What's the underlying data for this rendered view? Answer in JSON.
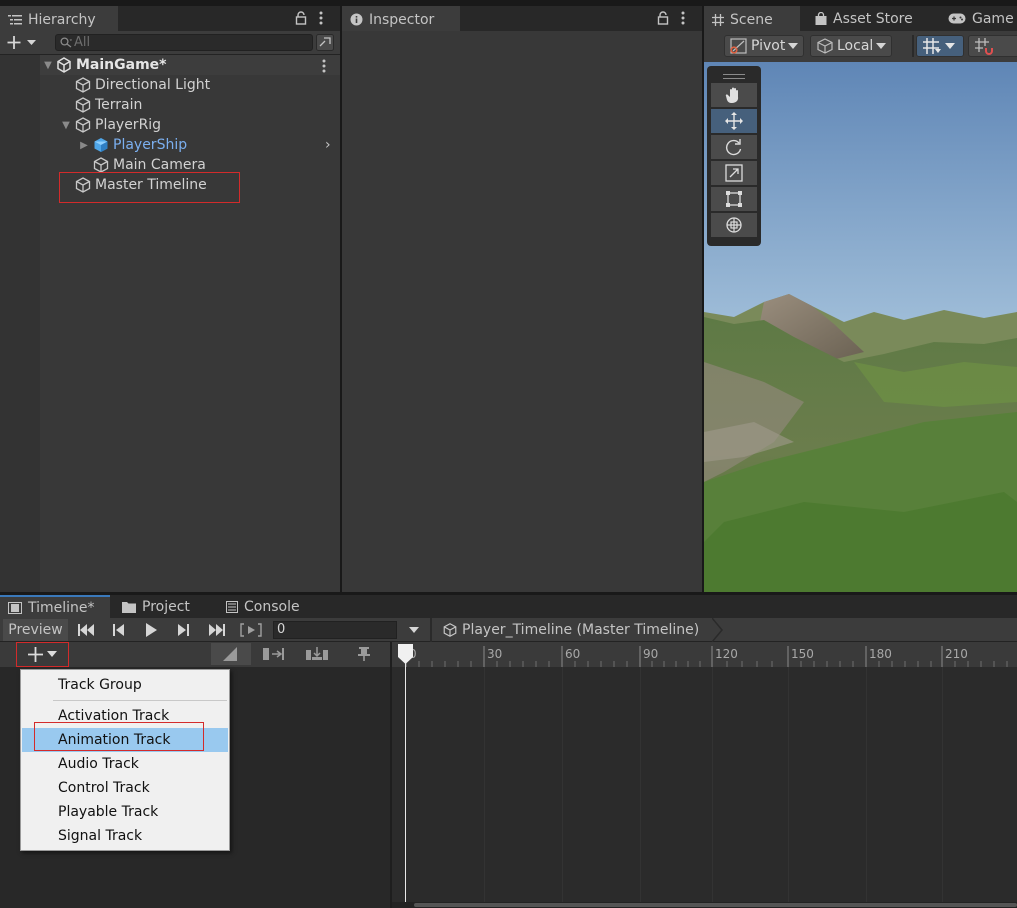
{
  "hierarchy": {
    "tab_label": "Hierarchy",
    "search_placeholder": "All",
    "scene_name": "MainGame*",
    "items": [
      {
        "label": "Directional Light"
      },
      {
        "label": "Terrain"
      },
      {
        "label": "PlayerRig"
      },
      {
        "label": "PlayerShip"
      },
      {
        "label": "Main Camera"
      },
      {
        "label": "Master Timeline"
      }
    ]
  },
  "inspector": {
    "tab_label": "Inspector"
  },
  "scene": {
    "tabs": [
      {
        "label": "Scene"
      },
      {
        "label": "Asset Store"
      },
      {
        "label": "Game"
      }
    ],
    "pivot_label": "Pivot",
    "local_label": "Local"
  },
  "timeline": {
    "tabs": [
      {
        "label": "Timeline*"
      },
      {
        "label": "Project"
      },
      {
        "label": "Console"
      }
    ],
    "preview_label": "Preview",
    "frame_value": "0",
    "breadcrumb": "Player_Timeline (Master Timeline)",
    "ruler_labels": [
      "0",
      "30",
      "60",
      "90",
      "120",
      "150",
      "180",
      "210"
    ]
  },
  "add_menu": {
    "items": [
      {
        "label": "Track Group"
      },
      {
        "label": "Activation Track"
      },
      {
        "label": "Animation Track"
      },
      {
        "label": "Audio Track"
      },
      {
        "label": "Control Track"
      },
      {
        "label": "Playable Track"
      },
      {
        "label": "Signal Track"
      }
    ]
  },
  "colors": {
    "highlight_box": "#d32b2b",
    "menu_selected": "#99c9ef",
    "prefab_text": "#7bafef"
  }
}
